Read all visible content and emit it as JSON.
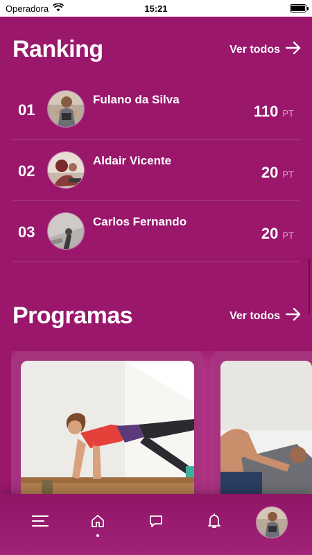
{
  "status_bar": {
    "carrier": "Operadora",
    "time": "15:21"
  },
  "ranking": {
    "title": "Ranking",
    "see_all_label": "Ver todos",
    "items": [
      {
        "position": "01",
        "name": "Fulano da Silva",
        "points": "110",
        "unit": "PT"
      },
      {
        "position": "02",
        "name": "Aldair Vicente",
        "points": "20",
        "unit": "PT"
      },
      {
        "position": "03",
        "name": "Carlos Fernando",
        "points": "20",
        "unit": "PT"
      }
    ]
  },
  "programs": {
    "title": "Programas",
    "see_all_label": "Ver todos"
  },
  "bottom_nav": {
    "items": [
      "menu-icon",
      "home-icon",
      "chat-icon",
      "bell-icon",
      "profile-avatar"
    ],
    "active": "home-icon"
  },
  "colors": {
    "background": "#9a176c",
    "text": "#ffffff",
    "muted": "#e9b6d6"
  }
}
